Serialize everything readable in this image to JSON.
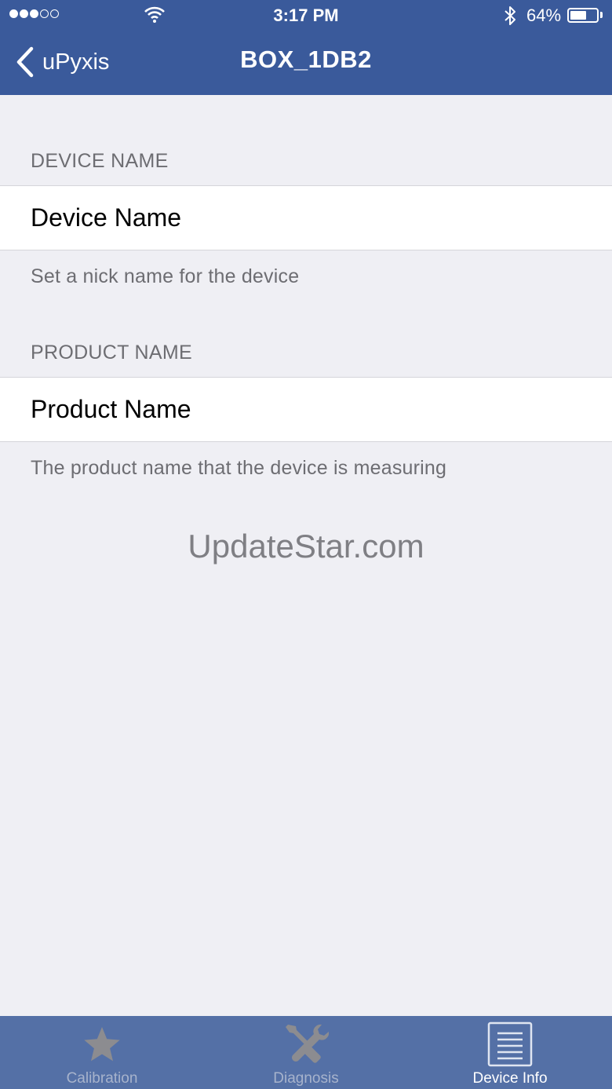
{
  "status_bar": {
    "time": "3:17 PM",
    "battery_percent": "64%",
    "battery_level": 0.64,
    "signal_bars_filled": 3,
    "signal_bars_total": 5,
    "icons": [
      "wifi-icon",
      "bluetooth-icon",
      "battery-icon"
    ]
  },
  "nav": {
    "back_label": "uPyxis",
    "title": "BOX_1DB2"
  },
  "sections": [
    {
      "header": "DEVICE NAME",
      "placeholder": "Device Name",
      "footer": "Set a nick name for the device"
    },
    {
      "header": "PRODUCT NAME",
      "placeholder": "Product Name",
      "footer": "The product name that the device is measuring"
    }
  ],
  "watermark": "UpdateStar.com",
  "tabs": [
    {
      "label": "Calibration",
      "icon": "star-icon",
      "active": false
    },
    {
      "label": "Diagnosis",
      "icon": "tools-icon",
      "active": false
    },
    {
      "label": "Device Info",
      "icon": "list-icon",
      "active": true
    }
  ],
  "colors": {
    "nav_bar": "#3a5a9b",
    "tab_bar": "#5470a6",
    "background": "#efeff4",
    "secondary_text": "#6d6d72"
  }
}
